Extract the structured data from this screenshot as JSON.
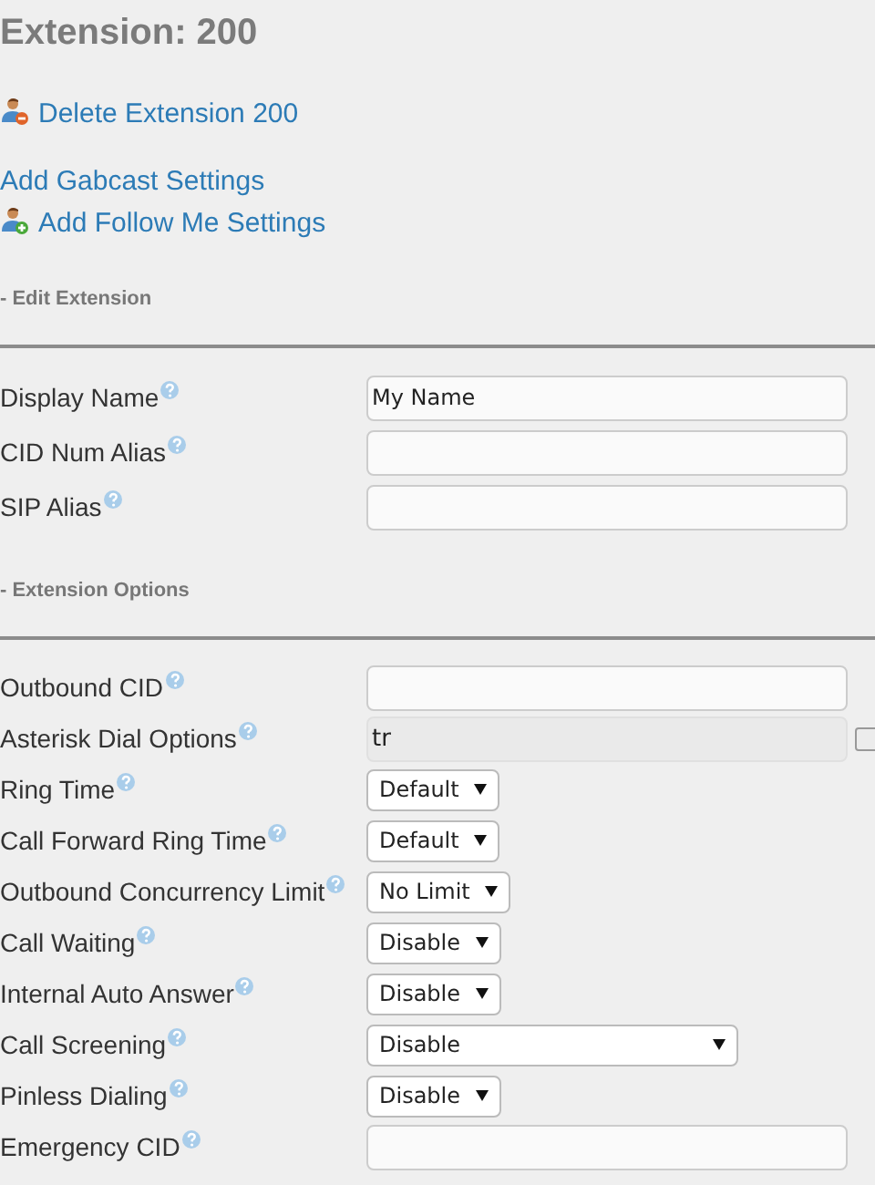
{
  "title": "Extension: 200",
  "link_groups": [
    [
      {
        "label": "Delete Extension 200",
        "kind": "remove"
      }
    ],
    [
      {
        "label": "Add Gabcast Settings",
        "kind": "plain"
      },
      {
        "label": "Add Follow Me Settings",
        "kind": "add"
      }
    ]
  ],
  "sections": [
    {
      "heading": "- Edit Extension",
      "rows": [
        {
          "label": "Display Name",
          "kind": "text",
          "value": "My Name"
        },
        {
          "label": "CID Num Alias",
          "kind": "text",
          "value": ""
        },
        {
          "label": "SIP Alias",
          "kind": "text",
          "value": ""
        }
      ]
    },
    {
      "heading": "- Extension Options",
      "rows": [
        {
          "label": "Outbound CID",
          "kind": "text",
          "value": ""
        },
        {
          "label": "Asterisk Dial Options",
          "kind": "readonly",
          "value": "tr",
          "checkbox": {
            "checked": false
          }
        },
        {
          "label": "Ring Time",
          "kind": "select",
          "value": "Default"
        },
        {
          "label": "Call Forward Ring Time",
          "kind": "select",
          "value": "Default"
        },
        {
          "label": "Outbound Concurrency Limit",
          "kind": "select",
          "value": "No Limit"
        },
        {
          "label": "Call Waiting",
          "kind": "select",
          "value": "Disable"
        },
        {
          "label": "Internal Auto Answer",
          "kind": "select",
          "value": "Disable"
        },
        {
          "label": "Call Screening",
          "kind": "wide-select",
          "value": "Disable"
        },
        {
          "label": "Pinless Dialing",
          "kind": "select",
          "value": "Disable"
        },
        {
          "label": "Emergency CID",
          "kind": "text",
          "value": ""
        }
      ]
    }
  ]
}
